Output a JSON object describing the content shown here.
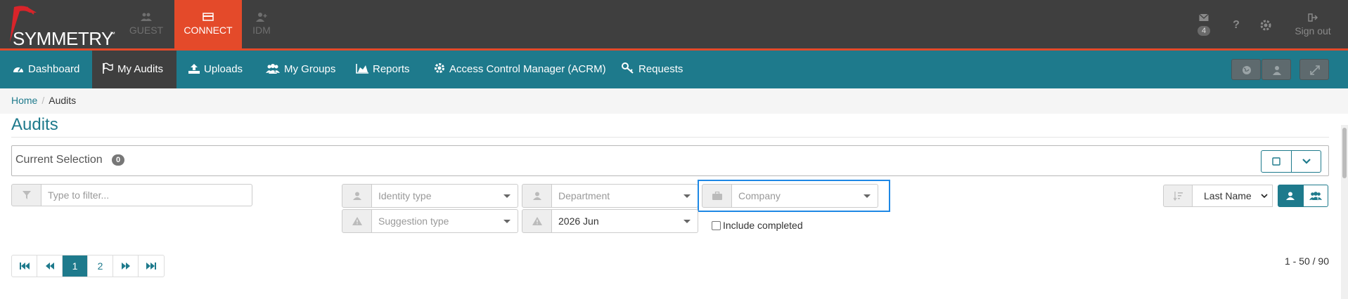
{
  "brand": {
    "name": "SYMMETRY",
    "tm": "™"
  },
  "apps": [
    {
      "label": "GUEST",
      "icon": "users-icon",
      "state": "disabled"
    },
    {
      "label": "CONNECT",
      "icon": "card-icon",
      "state": "active"
    },
    {
      "label": "IDM",
      "icon": "user-plus-icon",
      "state": "disabled"
    }
  ],
  "top_right": {
    "messages_count": "4",
    "help": "?",
    "signout": "Sign out"
  },
  "nav": [
    {
      "label": "Dashboard",
      "icon": "dashboard-icon"
    },
    {
      "label": "My Audits",
      "icon": "flag-icon",
      "active": true
    },
    {
      "label": "Uploads",
      "icon": "upload-icon"
    },
    {
      "label": "My Groups",
      "icon": "group-icon"
    },
    {
      "label": "Reports",
      "icon": "area-chart-icon"
    },
    {
      "label": "Access Control Manager (ACRM)",
      "icon": "gear-icon"
    },
    {
      "label": "Requests",
      "icon": "key-icon"
    }
  ],
  "breadcrumb": [
    "Home",
    "Audits"
  ],
  "page_title": "Audits",
  "selection": {
    "label": "Current Selection",
    "count": "0"
  },
  "filters": {
    "text_placeholder": "Type to filter...",
    "identity_type": "Identity type",
    "department": "Department",
    "company": "Company",
    "suggestion_type": "Suggestion type",
    "period": "2026 Jun",
    "include_completed": "Include completed"
  },
  "sort": {
    "value": "Last Name"
  },
  "pager": {
    "pages": [
      "1",
      "2"
    ],
    "range": "1 - 50 / 90"
  },
  "colors": {
    "accent": "#1e7a8c",
    "brand": "#e44a2a",
    "topbar": "#3f3f3f"
  }
}
